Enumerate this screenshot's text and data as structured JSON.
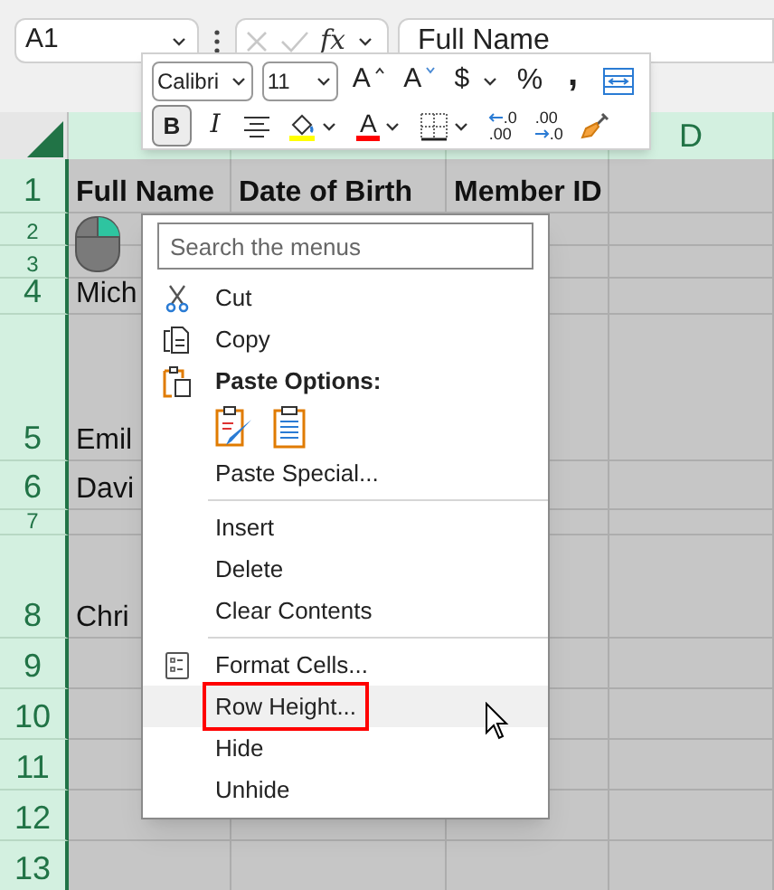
{
  "formula_bar": {
    "name_box": "A1",
    "function_label": "fx",
    "value": "Full Name"
  },
  "mini_toolbar": {
    "font": "Calibri",
    "size": "11",
    "top_buttons": [
      {
        "kind": "grow",
        "label": "A",
        "pressed": false
      },
      {
        "kind": "shrink",
        "label": "A",
        "pressed": false
      },
      {
        "kind": "currency",
        "label": "$",
        "pressed": false
      },
      {
        "kind": "percent",
        "label": "%",
        "pressed": false
      },
      {
        "kind": "comma",
        "label": ",",
        "pressed": false
      },
      {
        "kind": "merge",
        "pressed": false
      }
    ],
    "bottom_buttons": [
      {
        "kind": "bold",
        "label": "B",
        "pressed": true
      },
      {
        "kind": "italic",
        "label": "I",
        "pressed": false
      },
      {
        "kind": "align",
        "pressed": false
      },
      {
        "kind": "fill",
        "pressed": false
      },
      {
        "kind": "fontcolor",
        "label": "A",
        "pressed": false
      },
      {
        "kind": "borders",
        "pressed": false
      },
      {
        "kind": "incdec",
        "labels": [
          ".0",
          ".00"
        ],
        "pressed": false
      },
      {
        "kind": "decdec",
        "labels": [
          ".00",
          ".0"
        ],
        "pressed": false
      },
      {
        "kind": "painter",
        "pressed": false
      }
    ]
  },
  "column_header": "D",
  "rows": [
    {
      "header": "1",
      "cells": [
        "Full Name",
        "Date of Birth",
        "Member ID"
      ]
    },
    {
      "header": "2"
    },
    {
      "header": "3"
    },
    {
      "header": "4",
      "cells": [
        "Mich"
      ]
    },
    {
      "header": "5",
      "cells": [
        "Emil"
      ]
    },
    {
      "header": "6",
      "cells": [
        "Davi"
      ]
    },
    {
      "header": "7"
    },
    {
      "header": "8",
      "cells": [
        "Chri"
      ]
    },
    {
      "header": "9"
    },
    {
      "header": "10"
    },
    {
      "header": "11"
    },
    {
      "header": "12"
    },
    {
      "header": "13"
    }
  ],
  "context_menu": {
    "search_placeholder": "Search the menus",
    "items": [
      {
        "kind": "cut",
        "label": "Cut",
        "selected": false,
        "outlined": false
      },
      {
        "kind": "copy",
        "label": "Copy",
        "selected": false,
        "outlined": false
      },
      {
        "kind": "heading",
        "label": "Paste Options:"
      },
      {
        "kind": "paste_buttons"
      },
      {
        "kind": "item",
        "label": "Paste Special...",
        "selected": false,
        "outlined": false
      },
      {
        "kind": "separator"
      },
      {
        "kind": "item",
        "label": "Insert",
        "selected": false,
        "outlined": false
      },
      {
        "kind": "item",
        "label": "Delete",
        "selected": false,
        "outlined": false
      },
      {
        "kind": "item",
        "label": "Clear Contents",
        "selected": false,
        "outlined": false
      },
      {
        "kind": "separator"
      },
      {
        "kind": "format",
        "label": "Format Cells...",
        "selected": false,
        "outlined": false
      },
      {
        "kind": "item",
        "label": "Row Height...",
        "selected": true,
        "outlined": true
      },
      {
        "kind": "item",
        "label": "Hide",
        "selected": false,
        "outlined": false
      },
      {
        "kind": "item",
        "label": "Unhide",
        "selected": false,
        "outlined": false
      }
    ]
  }
}
